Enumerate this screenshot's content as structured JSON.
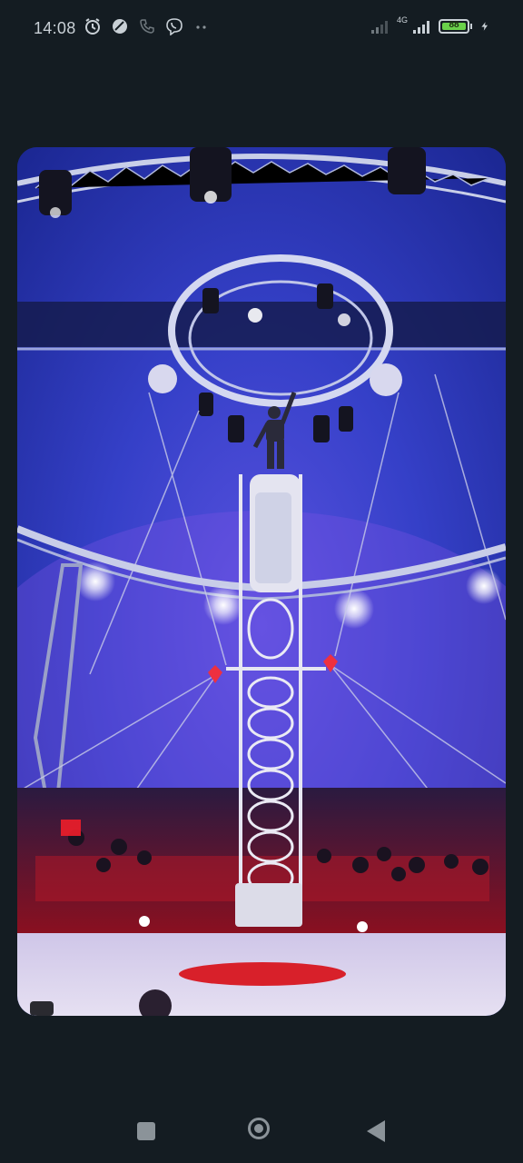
{
  "status_bar": {
    "time": "14:08",
    "network_label": "4G",
    "battery_level": "88",
    "left_icons": [
      "alarm-icon",
      "dnd-icon",
      "phone-icon",
      "viber-icon",
      "more-dots-icon"
    ],
    "right_icons": [
      "signal-weak-icon",
      "signal-4g-icon",
      "battery-icon",
      "charging-icon"
    ]
  },
  "media": {
    "type": "photo",
    "subject": "circus-wheel-act"
  },
  "nav_bar": {
    "buttons": [
      "recents-button",
      "home-button",
      "back-button"
    ]
  },
  "colors": {
    "background": "#141c22",
    "battery_fill": "#6ad14a",
    "icon": "#c9d0d6",
    "nav_icon": "#8b9399"
  }
}
